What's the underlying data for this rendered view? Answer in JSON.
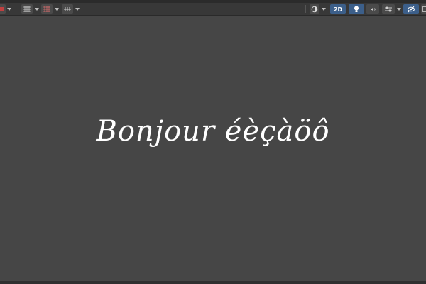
{
  "toolbar": {
    "twod_label": "2D",
    "icons": {
      "left_edge": "render-mode-icon",
      "toggle_1": "grid-toggle-icon",
      "toggle_2": "gizmo-grid-icon",
      "toggle_3": "snap-icon",
      "shading": "shading-mode-icon",
      "lighting": "lightbulb-icon",
      "audio": "audio-icon",
      "effects": "effects-icon",
      "hidden": "hidden-objects-icon",
      "gizmos": "gizmos-icon"
    },
    "active_color": "#3c5f8a"
  },
  "scene": {
    "text": "Bonjour éèçàöô",
    "text_color": "#ffffff",
    "background": "#464646"
  }
}
